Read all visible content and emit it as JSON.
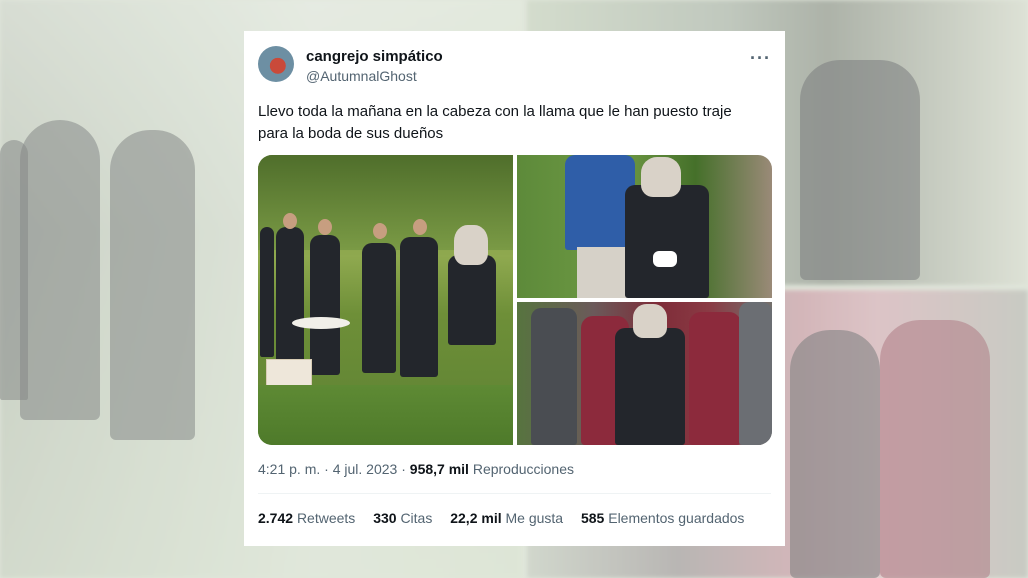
{
  "tweet": {
    "display_name": "cangrejo simpático",
    "handle": "@AutumnalGhost",
    "more_icon": "more-horizontal-icon",
    "text_line1": "Llevo toda la mañana en la cabeza con la llama que le han puesto traje",
    "text_line2": "para la boda de sus dueños",
    "time": "4:21 p. m.",
    "separator": "·",
    "date": "4 jul. 2023",
    "views_count": "958,7 mil",
    "views_label": "Reproducciones",
    "stats": [
      {
        "count": "2.742",
        "label": "Retweets"
      },
      {
        "count": "330",
        "label": "Citas"
      },
      {
        "count": "22,2 mil",
        "label": "Me gusta"
      },
      {
        "count": "585",
        "label": "Elementos guardados"
      }
    ]
  },
  "colors": {
    "text_primary": "#0f1419",
    "text_secondary": "#536471",
    "divider": "#eff3f4",
    "card_bg": "#ffffff"
  }
}
